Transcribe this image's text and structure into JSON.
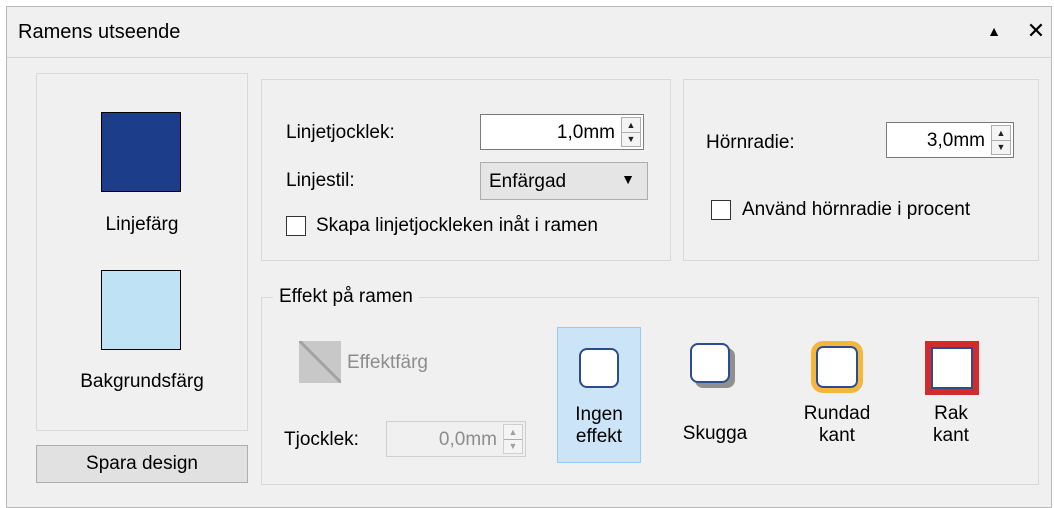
{
  "window": {
    "title": "Ramens utseende"
  },
  "colors": {
    "line_color": "#1c3d8a",
    "background_color": "#bfe3f5",
    "selected_effect_bg": "#cce4f7",
    "rounded_border": "#f5b73b",
    "straight_border": "#d12b2b"
  },
  "color_panel": {
    "line_color_label": "Linjefärg",
    "background_color_label": "Bakgrundsfärg"
  },
  "save_button": "Spara design",
  "line": {
    "thickness_label": "Linjetjocklek:",
    "thickness_value": "1,0mm",
    "style_label": "Linjestil:",
    "style_value": "Enfärgad",
    "inward_label": "Skapa linjetjockleken inåt i ramen",
    "inward_checked": false
  },
  "corner": {
    "radius_label": "Hörnradie:",
    "radius_value": "3,0mm",
    "percent_label": "Använd hörnradie i procent",
    "percent_checked": false
  },
  "effect": {
    "group_label": "Effekt på ramen",
    "color_label": "Effektfärg",
    "thickness_label": "Tjocklek:",
    "thickness_value": "0,0mm",
    "options": [
      {
        "line1": "Ingen",
        "line2": "effekt",
        "selected": true
      },
      {
        "line1": "Skugga",
        "line2": "",
        "selected": false
      },
      {
        "line1": "Rundad",
        "line2": "kant",
        "selected": false
      },
      {
        "line1": "Rak",
        "line2": "kant",
        "selected": false
      }
    ]
  }
}
